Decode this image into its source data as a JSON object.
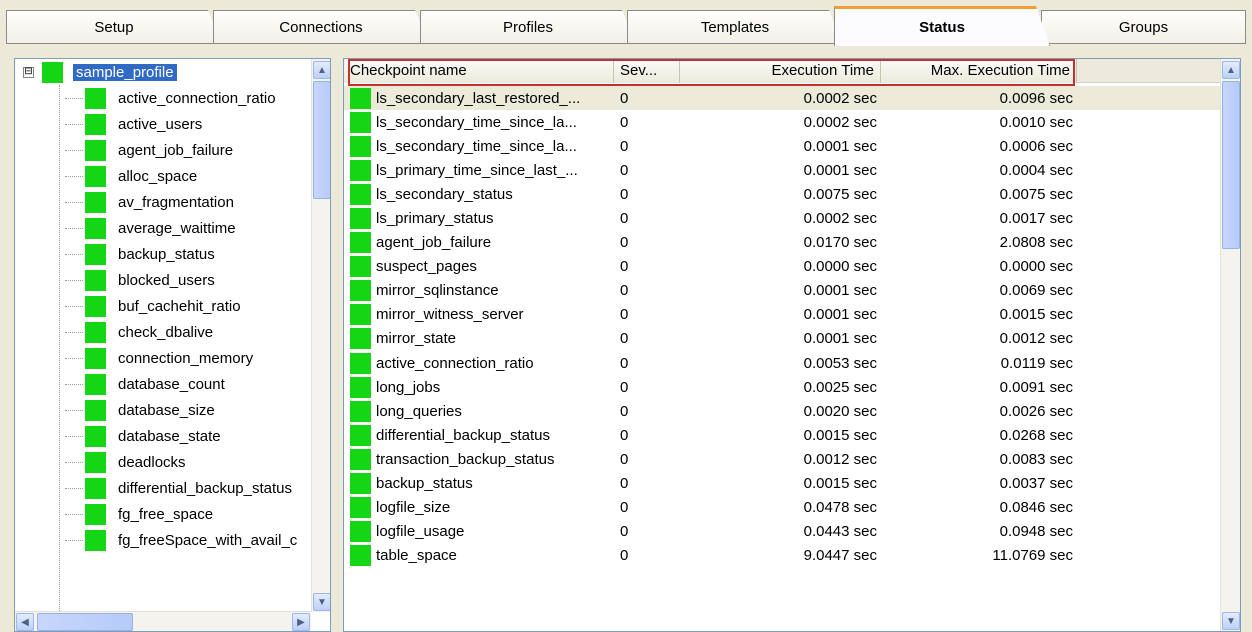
{
  "tabs": [
    {
      "label": "Setup",
      "active": false
    },
    {
      "label": "Connections",
      "active": false
    },
    {
      "label": "Profiles",
      "active": false
    },
    {
      "label": "Templates",
      "active": false
    },
    {
      "label": "Status",
      "active": true
    },
    {
      "label": "Groups",
      "active": false
    }
  ],
  "tree": {
    "root_label": "sample_profile",
    "expander": "⊟",
    "status_color": "#14d614",
    "items": [
      "active_connection_ratio",
      "active_users",
      "agent_job_failure",
      "alloc_space",
      "av_fragmentation",
      "average_waittime",
      "backup_status",
      "blocked_users",
      "buf_cachehit_ratio",
      "check_dbalive",
      "connection_memory",
      "database_count",
      "database_size",
      "database_state",
      "deadlocks",
      "differential_backup_status",
      "fg_free_space",
      "fg_freeSpace_with_avail_c"
    ]
  },
  "grid": {
    "columns": [
      "Checkpoint name",
      "Sev...",
      "Execution Time",
      "Max. Execution Time"
    ],
    "highlight_color": "#c4312e",
    "rows": [
      {
        "name": "ls_secondary_last_restored_...",
        "sev": "0",
        "exec": "0.0002 sec",
        "max": "0.0096 sec"
      },
      {
        "name": "ls_secondary_time_since_la...",
        "sev": "0",
        "exec": "0.0002 sec",
        "max": "0.0010 sec"
      },
      {
        "name": "ls_secondary_time_since_la...",
        "sev": "0",
        "exec": "0.0001 sec",
        "max": "0.0006 sec"
      },
      {
        "name": "ls_primary_time_since_last_...",
        "sev": "0",
        "exec": "0.0001 sec",
        "max": "0.0004 sec"
      },
      {
        "name": "ls_secondary_status",
        "sev": "0",
        "exec": "0.0075 sec",
        "max": "0.0075 sec"
      },
      {
        "name": "ls_primary_status",
        "sev": "0",
        "exec": "0.0002 sec",
        "max": "0.0017 sec"
      },
      {
        "name": "agent_job_failure",
        "sev": "0",
        "exec": "0.0170 sec",
        "max": "2.0808 sec"
      },
      {
        "name": "suspect_pages",
        "sev": "0",
        "exec": "0.0000 sec",
        "max": "0.0000 sec"
      },
      {
        "name": "mirror_sqlinstance",
        "sev": "0",
        "exec": "0.0001 sec",
        "max": "0.0069 sec"
      },
      {
        "name": "mirror_witness_server",
        "sev": "0",
        "exec": "0.0001 sec",
        "max": "0.0015 sec"
      },
      {
        "name": "mirror_state",
        "sev": "0",
        "exec": "0.0001 sec",
        "max": "0.0012 sec"
      },
      {
        "name": "active_connection_ratio",
        "sev": "0",
        "exec": "0.0053 sec",
        "max": "0.0119 sec"
      },
      {
        "name": "long_jobs",
        "sev": "0",
        "exec": "0.0025 sec",
        "max": "0.0091 sec"
      },
      {
        "name": "long_queries",
        "sev": "0",
        "exec": "0.0020 sec",
        "max": "0.0026 sec"
      },
      {
        "name": "differential_backup_status",
        "sev": "0",
        "exec": "0.0015 sec",
        "max": "0.0268 sec"
      },
      {
        "name": "transaction_backup_status",
        "sev": "0",
        "exec": "0.0012 sec",
        "max": "0.0083 sec"
      },
      {
        "name": "backup_status",
        "sev": "0",
        "exec": "0.0015 sec",
        "max": "0.0037 sec"
      },
      {
        "name": "logfile_size",
        "sev": "0",
        "exec": "0.0478 sec",
        "max": "0.0846 sec"
      },
      {
        "name": "logfile_usage",
        "sev": "0",
        "exec": "0.0443 sec",
        "max": "0.0948 sec"
      },
      {
        "name": "table_space",
        "sev": "0",
        "exec": "9.0447 sec",
        "max": "11.0769 sec"
      }
    ]
  }
}
